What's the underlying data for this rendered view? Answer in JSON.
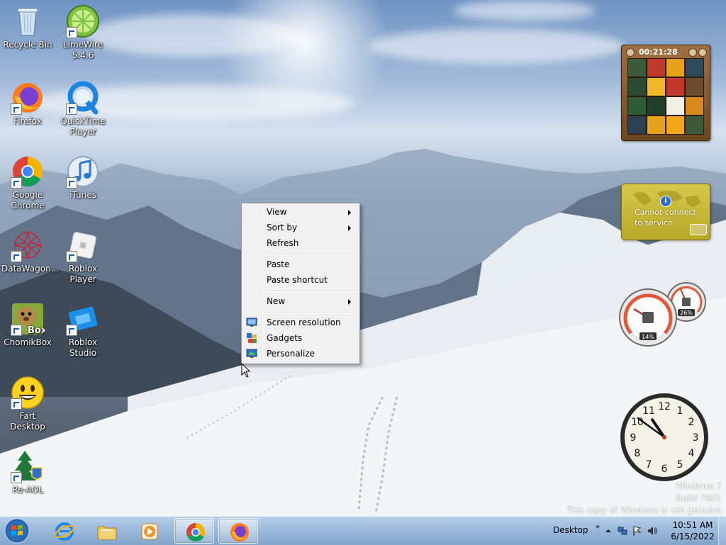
{
  "desktop": {
    "icons": [
      {
        "label": "Recycle Bin",
        "icon": "recycle-bin-icon"
      },
      {
        "label": "LimeWire 5.4.6",
        "icon": "limewire-icon"
      },
      {
        "label": "Firefox",
        "icon": "firefox-icon"
      },
      {
        "label": "QuickTime Player",
        "icon": "quicktime-icon"
      },
      {
        "label": "Google Chrome",
        "icon": "chrome-icon"
      },
      {
        "label": "iTunes",
        "icon": "itunes-icon"
      },
      {
        "label": "DataWagon...",
        "icon": "datawagon-icon"
      },
      {
        "label": "Roblox Player",
        "icon": "roblox-player-icon"
      },
      {
        "label": "ChomikBox",
        "icon": "chomikbox-icon"
      },
      {
        "label": "Roblox Studio",
        "icon": "roblox-studio-icon"
      },
      {
        "label": "Fart Desktop",
        "icon": "smiley-icon"
      },
      {
        "label": "Re-AOL",
        "icon": "re-aol-icon"
      }
    ]
  },
  "context_menu": {
    "items": [
      {
        "label": "View",
        "submenu": true
      },
      {
        "label": "Sort by",
        "submenu": true
      },
      {
        "label": "Refresh",
        "submenu": false
      },
      {
        "label": "Paste",
        "submenu": false
      },
      {
        "label": "Paste shortcut",
        "submenu": false
      },
      {
        "label": "New",
        "submenu": true
      },
      {
        "label": "Screen resolution",
        "icon": "screen-resolution-icon"
      },
      {
        "label": "Gadgets",
        "icon": "gadgets-icon"
      },
      {
        "label": "Personalize",
        "icon": "personalize-icon"
      }
    ]
  },
  "gadgets": {
    "puzzle_time": "00:21:28",
    "weather_message": "Cannot connect to service",
    "cpu_meter": {
      "cpu_percent": "14%",
      "memory_percent": "26%"
    },
    "clock": {
      "hour": 10,
      "minute": 51,
      "numbers": [
        "12",
        "1",
        "2",
        "3",
        "4",
        "5",
        "6",
        "7",
        "8",
        "9",
        "10",
        "11"
      ]
    }
  },
  "watermark": {
    "line1": "Windows 7",
    "line2": "Build 7601",
    "line3": "This copy of Windows is not genuine"
  },
  "taskbar": {
    "pinned": [
      "internet-explorer-icon",
      "windows-explorer-icon",
      "media-player-icon",
      "chrome-icon",
      "firefox-icon"
    ],
    "tray_desktop_label": "Desktop",
    "tray_chevron": "»",
    "time": "10:51 AM",
    "date": "6/15/2022"
  },
  "colors": {
    "taskbar": "#96b6da",
    "menu_bg": "#f0f0f0",
    "weather_bg": "#d6c94a"
  }
}
